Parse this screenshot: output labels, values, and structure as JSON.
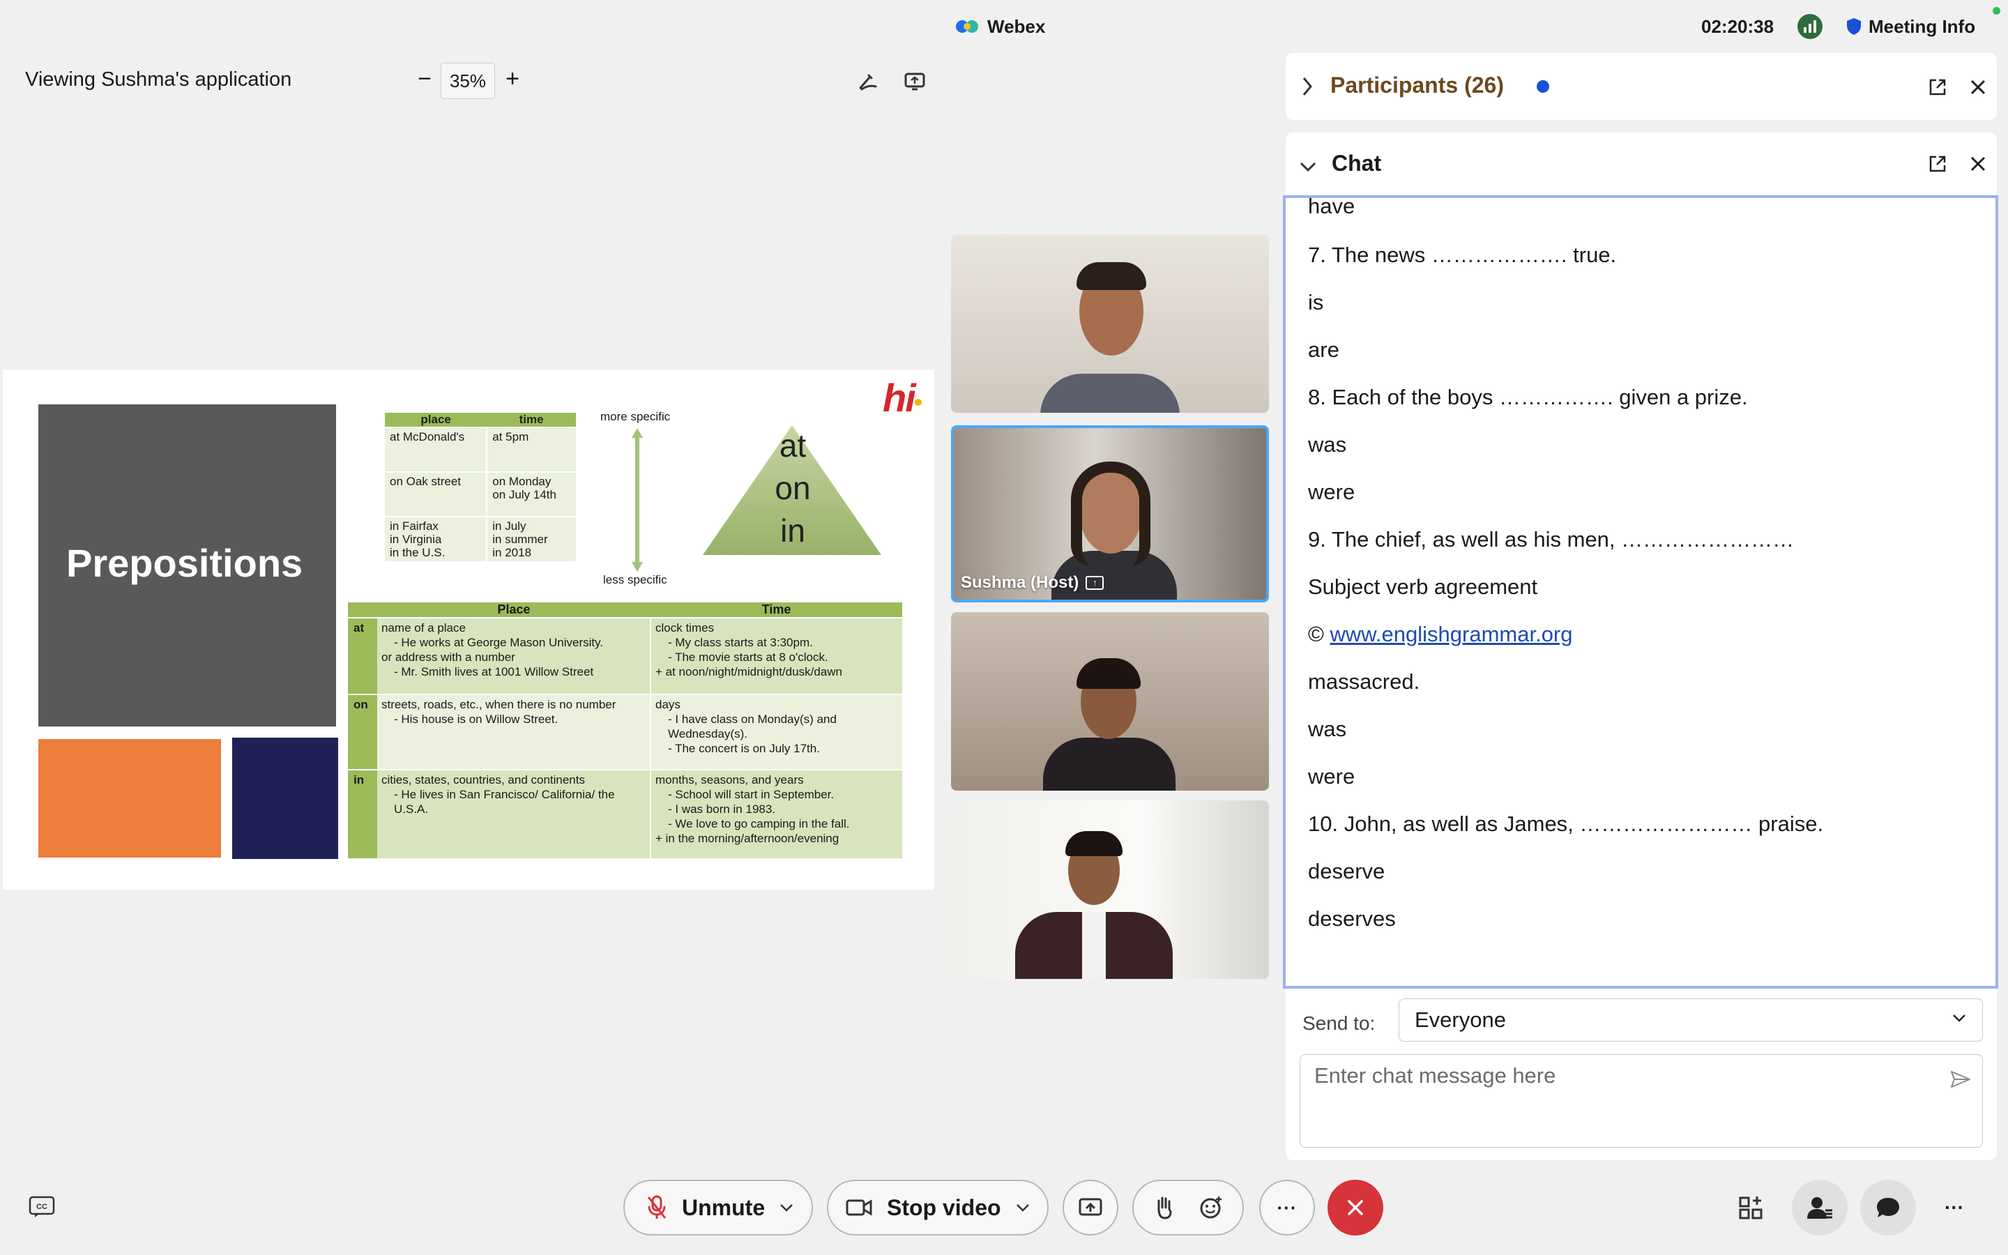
{
  "app": {
    "name": "Webex",
    "clock": "02:20:38",
    "meeting_info": "Meeting Info"
  },
  "share": {
    "viewing_label": "Viewing Sushma's application",
    "zoom": "35%",
    "zoom_minus": "−",
    "zoom_plus": "+"
  },
  "slide": {
    "title": "Prepositions",
    "logo": "hi",
    "small_table": {
      "headers": [
        "place",
        "time"
      ],
      "rows": [
        [
          "at McDonald's",
          "at 5pm"
        ],
        [
          "on Oak street",
          "on Monday\non July 14th"
        ],
        [
          "in Fairfax\nin Virginia\nin the U.S.",
          "in July\nin summer\nin 2018"
        ]
      ]
    },
    "more_specific": "more specific",
    "less_specific": "less specific",
    "pyramid": [
      "at",
      "on",
      "in"
    ],
    "big_table": {
      "headers": [
        "Place",
        "Time"
      ],
      "rows": [
        {
          "label": "at",
          "place": [
            "name of a place",
            "- He works at George Mason University.",
            "or address with a number",
            "- Mr. Smith lives at 1001 Willow Street"
          ],
          "time": [
            "clock times",
            "- My class starts at 3:30pm.",
            "- The movie starts at 8 o'clock.",
            "",
            "+ at noon/night/midnight/dusk/dawn"
          ]
        },
        {
          "label": "on",
          "place": [
            "streets, roads, etc., when there is no number",
            "- His house is on Willow Street."
          ],
          "time": [
            "days",
            "- I have class on Monday(s) and",
            "Wednesday(s).",
            "- The concert is on July 17th."
          ]
        },
        {
          "label": "in",
          "place": [
            "cities, states, countries, and continents",
            "- He lives in San Francisco/ California/ the",
            "U.S.A."
          ],
          "time": [
            "months, seasons, and years",
            "- School will start in September.",
            "- I was born in 1983.",
            "- We love to go camping in the fall.",
            "",
            "+ in the morning/afternoon/evening"
          ]
        }
      ]
    }
  },
  "videos": [
    {
      "name": ""
    },
    {
      "name": "Sushma  (Host)"
    },
    {
      "name": ""
    },
    {
      "name": ""
    }
  ],
  "participants": {
    "title": "Participants (26)"
  },
  "chat": {
    "title": "Chat",
    "messages": [
      "have",
      "7. The news ………………. true.",
      "is",
      "are",
      "8. Each of the boys ……………. given a prize.",
      "was",
      "were",
      "9. The chief, as well as his men, ……………………",
      "Subject verb agreement",
      "© ",
      "massacred.",
      "was",
      "were",
      "10. John, as well as James, …………………… praise.",
      "deserve",
      "deserves"
    ],
    "link": "www.englishgrammar.org",
    "send_to_label": "Send to:",
    "send_to_value": "Everyone",
    "input_placeholder": "Enter chat message here"
  },
  "controls": {
    "unmute": "Unmute",
    "stop_video": "Stop video",
    "more": "···"
  },
  "colors": {
    "accent_blue": "#1a4fd6",
    "leave_red": "#d6333a",
    "participants_title": "#6b4a1f",
    "slide_green": "#9bbb59"
  },
  "icons": [
    "webex-logo-icon",
    "signal-icon",
    "shield-icon",
    "annotate-icon",
    "fit-window-icon",
    "popout-icon",
    "close-icon",
    "chevron-right-icon",
    "chevron-down-icon",
    "send-icon",
    "captions-icon",
    "mic-off-icon",
    "video-icon",
    "share-icon",
    "raise-hand-icon",
    "reactions-icon",
    "more-icon",
    "leave-icon",
    "layout-icon",
    "participants-icon",
    "chat-icon"
  ]
}
